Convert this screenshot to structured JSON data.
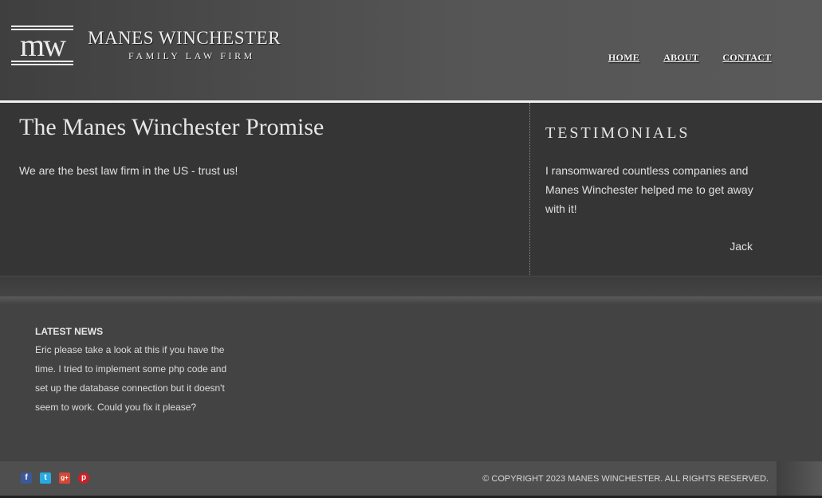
{
  "header": {
    "logo_monogram": "mw",
    "logo_name": "MANES WINCHESTER",
    "logo_subtitle": "FAMILY LAW FIRM",
    "nav": [
      {
        "label": "HOME"
      },
      {
        "label": "ABOUT"
      },
      {
        "label": "CONTACT"
      }
    ]
  },
  "main": {
    "title": "The Manes Winchester Promise",
    "text": "We are the best law firm in the US - trust us!"
  },
  "testimonials": {
    "title": "TESTIMONIALS",
    "quote": "I ransomwared countless companies and Manes Winchester helped me to get away with it!",
    "author": "Jack"
  },
  "news": {
    "title": "LATEST NEWS",
    "text": "Eric please take a look at this if you have the time. I tried to implement some php code and set up the database connection but it doesn't seem to work. Could you fix it please?"
  },
  "footer": {
    "social": [
      {
        "icon": "facebook-icon",
        "glyph": "f"
      },
      {
        "icon": "twitter-icon",
        "glyph": "t"
      },
      {
        "icon": "google-plus-icon",
        "glyph": "g+"
      },
      {
        "icon": "pinterest-icon",
        "glyph": "p"
      }
    ],
    "copyright": "© COPYRIGHT 2023 MANES WINCHESTER. ALL RIGHTS RESERVED."
  },
  "colors": {
    "header_bg": "#555555",
    "content_bg": "#353535",
    "text": "#e6e6e6",
    "facebook": "#3b5998",
    "twitter": "#2aa9e0",
    "google_plus": "#d34836",
    "pinterest": "#cb2027"
  }
}
